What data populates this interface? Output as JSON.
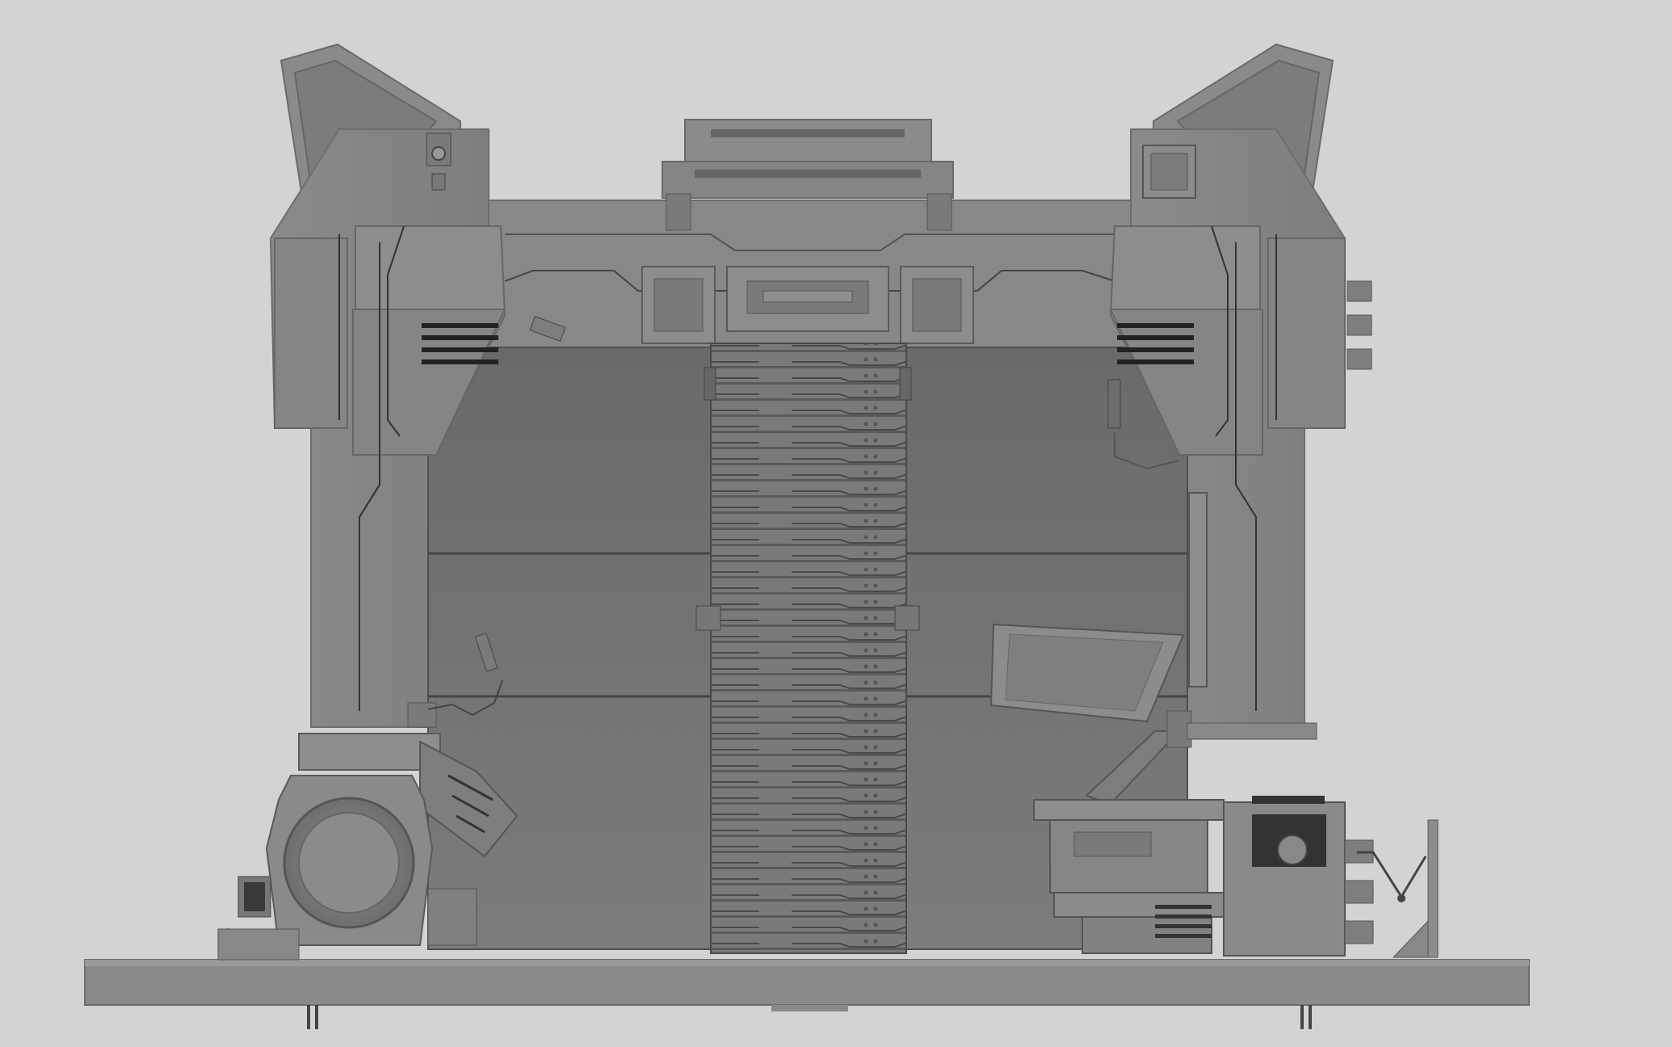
{
  "scene": {
    "subject": "sci-fi-hangar-door-3d-render",
    "colors": {
      "background": "#d3d3d3",
      "frame_light": "#8f8f8f",
      "frame_mid": "#828282",
      "frame_dark": "#6d6d6d",
      "panel": "#747474",
      "panel_dark": "#5f5f5f",
      "slot": "#222222",
      "line": "#333333"
    }
  }
}
